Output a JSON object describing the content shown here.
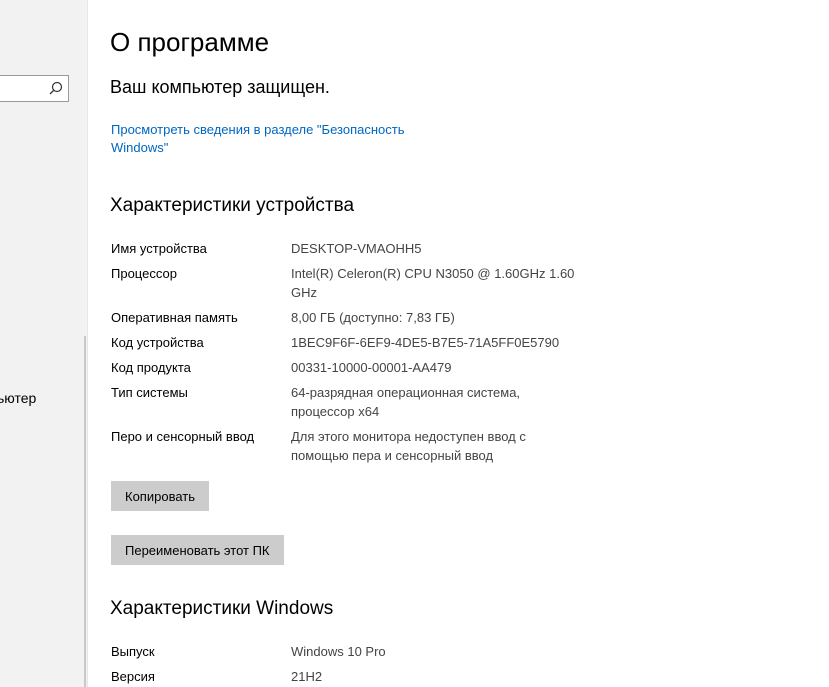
{
  "sidebar": {
    "item_label": "ьютер"
  },
  "header": {
    "title": "О программе",
    "protected_text": "Ваш компьютер защищен.",
    "security_link": "Просмотреть сведения в разделе \"Безопасность Windows\""
  },
  "device_specs": {
    "title": "Характеристики устройства",
    "rows": [
      {
        "label": "Имя устройства",
        "value": "DESKTOP-VMAOHH5"
      },
      {
        "label": "Процессор",
        "value": "Intel(R) Celeron(R) CPU  N3050  @ 1.60GHz   1.60 GHz"
      },
      {
        "label": "Оперативная память",
        "value": "8,00 ГБ (доступно: 7,83 ГБ)"
      },
      {
        "label": "Код устройства",
        "value": "1BEC9F6F-6EF9-4DE5-B7E5-71A5FF0E5790"
      },
      {
        "label": "Код продукта",
        "value": "00331-10000-00001-AA479"
      },
      {
        "label": "Тип системы",
        "value": "64-разрядная операционная система, процессор x64"
      },
      {
        "label": "Перо и сенсорный ввод",
        "value": "Для этого монитора недоступен ввод с помощью пера и сенсорный ввод"
      }
    ],
    "copy_button": "Копировать",
    "rename_button": "Переименовать этот ПК"
  },
  "windows_specs": {
    "title": "Характеристики Windows",
    "rows": [
      {
        "label": "Выпуск",
        "value": "Windows 10 Pro"
      },
      {
        "label": "Версия",
        "value": "21H2"
      }
    ]
  },
  "colors": {
    "link": "#0067c0",
    "button_bg": "#cccccc",
    "sidebar_bg": "#f2f2f2"
  }
}
